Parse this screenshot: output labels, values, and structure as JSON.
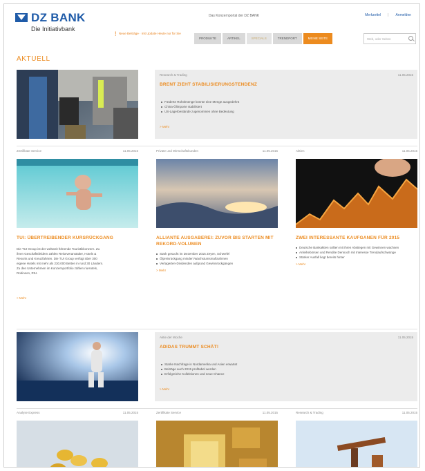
{
  "header": {
    "brand": "DZ BANK",
    "brand_sub": "Die Initiativbank",
    "tagline": "Das Konzernportal der DZ BANK",
    "links": [
      "Merkzettel",
      "Anmelden"
    ],
    "notice": "Neue Beiträge · mit Update Heute nur für Sie"
  },
  "nav": {
    "tabs": [
      "PRODUKTE",
      "ARTIKEL",
      "SPECIALS",
      "TRENDPORT",
      "MEINE SEITE"
    ],
    "search_placeholder": "Web, oder Seiten"
  },
  "section_title": "AKTUELL",
  "feature1": {
    "category": "Research & Trading",
    "date": "11.05.2015",
    "title": "BRENT ZIEHT STABILISIERUNGSTENDENZ",
    "bullets": [
      "Förderte Rohölmenge könnte eine Menge ausgedehnt",
      "China-Ölimporte stabilisiert",
      "US-Lagerbestände zugenommen ohne Bedeutung"
    ],
    "more": "> Mehr"
  },
  "cols1": [
    {
      "category": "Zertifikate Service",
      "date": "11.05.2015",
      "title": "TUI: ÜBERTREIBENDER KURSRÜCKGANG",
      "text": "Die TUI Group ist der weltweit führende Touristikkonzern. Zu ihren Geschäftsfeldern zählen Reiseveranstalter, Hotels & Resorts und Kreuzfahrten. Die TUI Group verfügt über 300 eigene Hotels mit mehr als 230.000 Betten in rund 30 Ländern. Zu den Unternehmen im Konzernportfolio zählen riuHotels, Robinson, RIU.",
      "bullets": [],
      "more": "> Mehr"
    },
    {
      "category": "Private und Wirtschaftskunden",
      "date": "11.05.2015",
      "title": "ALLIANTE AUSGABEREI: ZUVOR BIS STARTEN MIT REKORD-VOLUMEN",
      "text": "",
      "bullets": [
        "Stark gesucht im Dezember 2015 Zeyen, Schwefel",
        "Ölpreisrückgang mindert Wachstumsmaßnahmen",
        "Verlagerten-Dividenden aufgrund Gewinnrückgängen"
      ],
      "more": "> Mehr"
    },
    {
      "category": "Aktien",
      "date": "11.05.2015",
      "title": "ZWEI INTERESSANTE KAUFGANEN FÜR 2015",
      "text": "",
      "bullets": [
        "Deutsche Bankaktien sollten mit ihren Abstiegen mit Gewinnen wachsen",
        "Anleihebörsen und Rendite Dennoch mit Interesse Trendaufschwünge",
        "Stärker Ausfall liegt bereits hinter"
      ],
      "more": "> Mehr"
    }
  ],
  "feature2": {
    "category": "Aktie der Woche",
    "date": "11.05.2015",
    "title": "ADIDAS TRUMMT SCHÄT!",
    "bullets": [
      "Starke Nachfrage in Nordamerika und Asien erwartet",
      "Beiträge auch 2015 profitabel werden",
      "Erfolgreiche Kollektionen und neue Chance"
    ],
    "more": "> Mehr"
  },
  "cols2": [
    {
      "category": "Analyse Express",
      "date": "11.05.2015"
    },
    {
      "category": "Zertifikate Service",
      "date": "11.05.2015"
    },
    {
      "category": "Research & Trading",
      "date": "11.05.2015"
    }
  ]
}
